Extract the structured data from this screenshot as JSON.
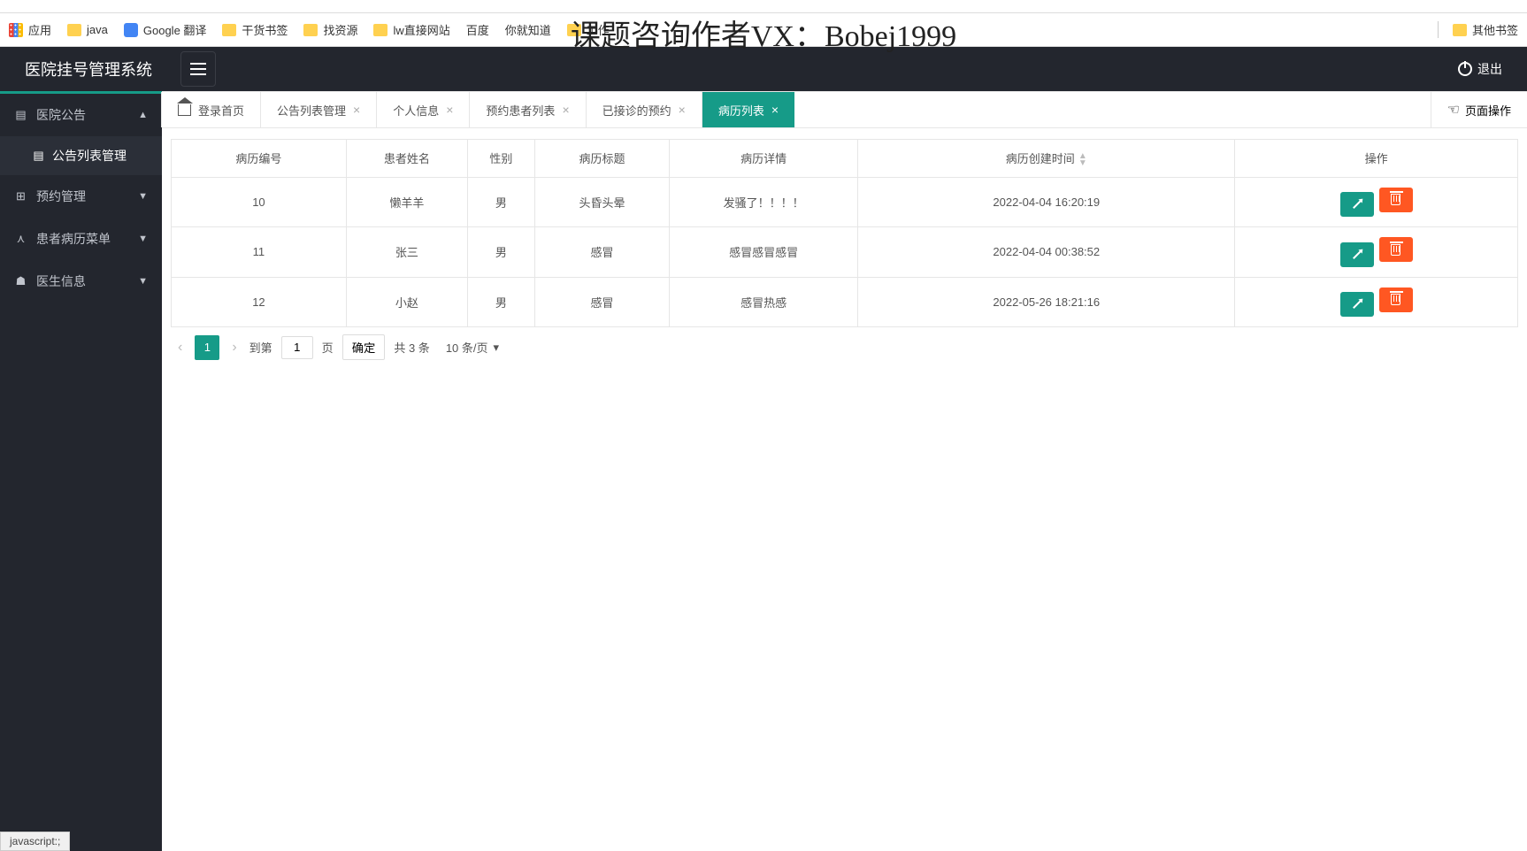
{
  "watermark": "课题咨询作者VX：Bobej1999",
  "bookmarks": {
    "apps": "应用",
    "items": [
      "java",
      "Google 翻译",
      "干货书签",
      "找资源",
      "lw直接网站",
      "百度",
      "你就知道",
      "工作"
    ],
    "other": "其他书签"
  },
  "app": {
    "title": "医院挂号管理系统",
    "logout": "退出"
  },
  "sidebar": {
    "items": [
      {
        "label": "医院公告",
        "expanded": true
      },
      {
        "label": "公告列表管理",
        "sub": true
      },
      {
        "label": "预约管理",
        "expanded": false
      },
      {
        "label": "患者病历菜单",
        "expanded": false
      },
      {
        "label": "医生信息",
        "expanded": false
      }
    ]
  },
  "tabs": {
    "items": [
      {
        "label": "登录首页",
        "closable": false,
        "home": true
      },
      {
        "label": "公告列表管理",
        "closable": true
      },
      {
        "label": "个人信息",
        "closable": true
      },
      {
        "label": "预约患者列表",
        "closable": true
      },
      {
        "label": "已接诊的预约",
        "closable": true
      },
      {
        "label": "病历列表",
        "closable": true,
        "active": true
      }
    ],
    "pageOps": "页面操作"
  },
  "table": {
    "headers": [
      "病历编号",
      "患者姓名",
      "性别",
      "病历标题",
      "病历详情",
      "病历创建时间",
      "操作"
    ],
    "rows": [
      {
        "id": "10",
        "name": "懒羊羊",
        "sex": "男",
        "title": "头昏头晕",
        "detail": "发骚了！！！！",
        "time": "2022-04-04 16:20:19"
      },
      {
        "id": "11",
        "name": "张三",
        "sex": "男",
        "title": "感冒",
        "detail": "感冒感冒感冒",
        "time": "2022-04-04 00:38:52"
      },
      {
        "id": "12",
        "name": "小赵",
        "sex": "男",
        "title": "感冒",
        "detail": "感冒热感",
        "time": "2022-05-26 18:21:16"
      }
    ]
  },
  "pagination": {
    "current": "1",
    "gotoLabel": "到第",
    "pageLabel": "页",
    "confirm": "确定",
    "total": "共 3 条",
    "pageSize": "10 条/页",
    "inputValue": "1"
  },
  "status": "javascript:;"
}
